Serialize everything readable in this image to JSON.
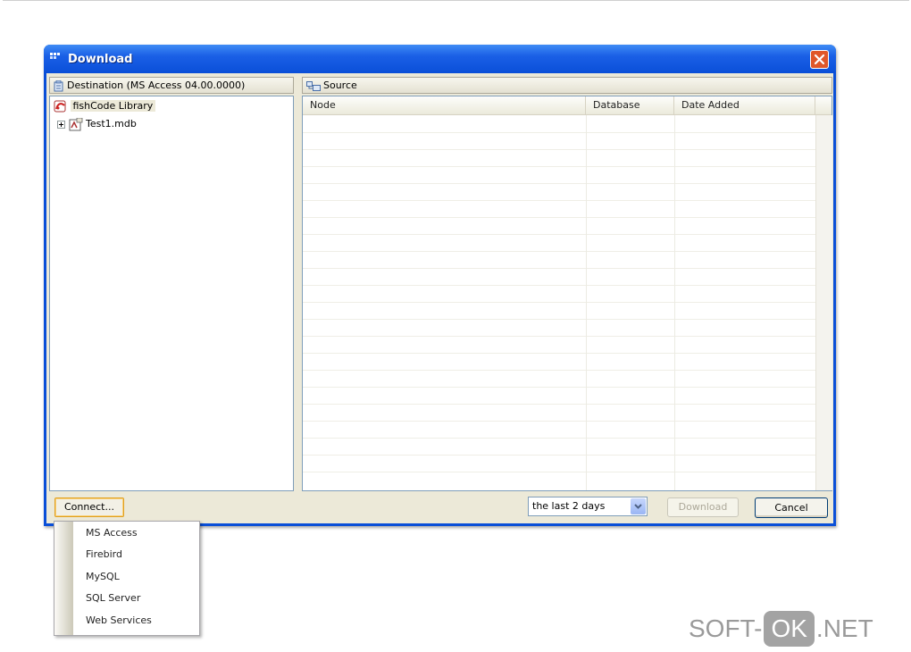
{
  "window": {
    "title": "Download"
  },
  "left_pane": {
    "header": "Destination (MS Access 04.00.0000)",
    "tree": [
      {
        "label": "fishCode Library"
      },
      {
        "label": "Test1.mdb"
      }
    ]
  },
  "right_pane": {
    "header": "Source",
    "columns": [
      "Node",
      "Database",
      "Date Added"
    ]
  },
  "footer": {
    "connect_label": "Connect...",
    "range_value": "the last 2 days",
    "download_label": "Download",
    "cancel_label": "Cancel"
  },
  "connect_menu": {
    "items": [
      "MS Access",
      "Firebird",
      "MySQL",
      "SQL Server",
      "Web Services"
    ]
  },
  "watermark": {
    "left": "SOFT-",
    "badge": "OK",
    "right": ".NET"
  }
}
